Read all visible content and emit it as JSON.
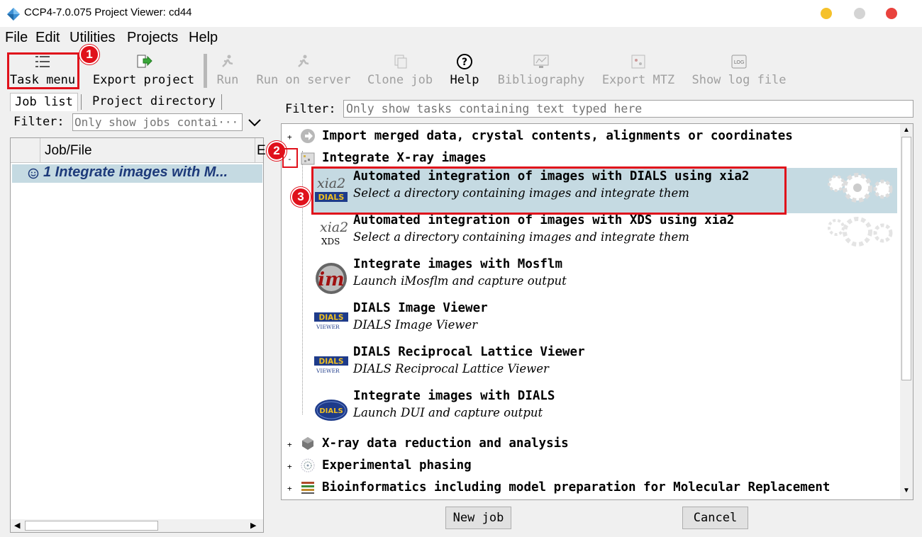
{
  "window": {
    "title": "CCP4-7.0.075 Project Viewer: cd44"
  },
  "menubar": [
    "File",
    "Edit",
    "Utilities",
    "Projects",
    "Help"
  ],
  "toolbar": [
    {
      "label": "Task menu",
      "icon": "task-menu-icon",
      "enabled": true
    },
    {
      "label": "Export project",
      "icon": "export-icon",
      "enabled": true
    },
    {
      "label": "Run",
      "icon": "run-icon",
      "enabled": false
    },
    {
      "label": "Run on server",
      "icon": "run-server-icon",
      "enabled": false
    },
    {
      "label": "Clone job",
      "icon": "clone-icon",
      "enabled": false
    },
    {
      "label": "Help",
      "icon": "help-icon",
      "enabled": true
    },
    {
      "label": "Bibliography",
      "icon": "bibliography-icon",
      "enabled": false
    },
    {
      "label": "Export MTZ",
      "icon": "export-mtz-icon",
      "enabled": false
    },
    {
      "label": "Show log file",
      "icon": "log-file-icon",
      "enabled": false
    }
  ],
  "left": {
    "tabs": [
      "Job list",
      "Project directory"
    ],
    "filter_label": "Filter:",
    "filter_placeholder": "Only show jobs contai···",
    "columns": [
      "Job/File",
      "E"
    ],
    "jobs": [
      {
        "label": "1 Integrate images with M..."
      }
    ]
  },
  "right": {
    "filter_label": "Filter:",
    "filter_placeholder": "Only show tasks containing text typed here",
    "categories": {
      "import": "Import merged data, crystal contents, alignments or coordinates",
      "integrate": "Integrate X-ray images",
      "reduction": "X-ray data reduction and analysis",
      "phasing": "Experimental phasing",
      "bioinfo": "Bioinformatics including model preparation for Molecular Replacement"
    },
    "tasks": [
      {
        "title": "Automated integration of images with DIALS using xia2",
        "desc": "Select a directory containing images and integrate them"
      },
      {
        "title": "Automated integration of images with XDS using xia2",
        "desc": "Select a directory containing images and integrate them"
      },
      {
        "title": "Integrate images with Mosflm",
        "desc": "Launch iMosflm and capture output"
      },
      {
        "title": "DIALS Image Viewer",
        "desc": "DIALS Image Viewer"
      },
      {
        "title": "DIALS Reciprocal Lattice Viewer",
        "desc": "DIALS Reciprocal Lattice Viewer"
      },
      {
        "title": "Integrate images with DIALS",
        "desc": "Launch DUI and capture output"
      }
    ],
    "icon_text": {
      "xia2": "xia2",
      "dials": "DIALS",
      "xds": "XDS",
      "viewer": "VIEWER",
      "im": "im"
    },
    "new_job": "New job",
    "cancel": "Cancel"
  },
  "annotations": [
    "1",
    "2",
    "3"
  ],
  "colors": {
    "highlight": "#c5dae2",
    "annotation_red": "#e0111b",
    "selection_row": "#cce4f7"
  }
}
